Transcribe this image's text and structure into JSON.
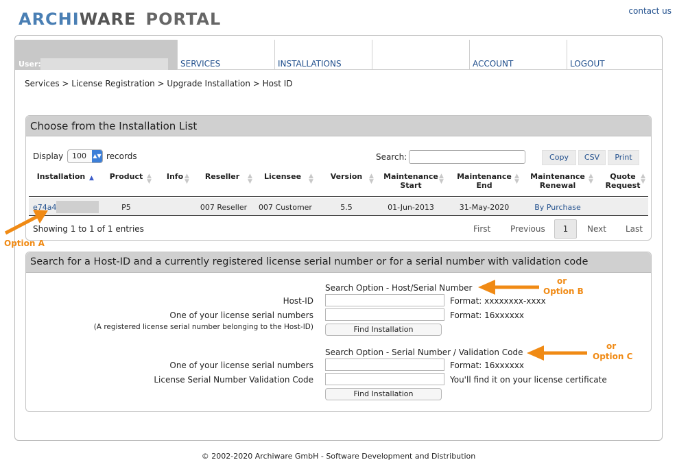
{
  "header": {
    "logo": {
      "part1": "ARCHI",
      "part2": "WARE",
      "part3": "PORTAL"
    },
    "contact": "contact us"
  },
  "nav": {
    "user_label": "User:",
    "tabs": [
      "SERVICES",
      "INSTALLATIONS",
      "",
      "ACCOUNT",
      "LOGOUT"
    ]
  },
  "breadcrumb": "Services > License Registration > Upgrade Installation > Host ID",
  "installation_list": {
    "title": "Choose from the Installation List",
    "display_label": "Display",
    "display_value": "100",
    "records_label": "records",
    "search_label": "Search:",
    "buttons": {
      "copy": "Copy",
      "csv": "CSV",
      "print": "Print"
    },
    "columns": [
      {
        "l1": "Installation",
        "l2": ""
      },
      {
        "l1": "Product",
        "l2": ""
      },
      {
        "l1": "Info",
        "l2": ""
      },
      {
        "l1": "Reseller",
        "l2": ""
      },
      {
        "l1": "Licensee",
        "l2": ""
      },
      {
        "l1": "Version",
        "l2": ""
      },
      {
        "l1": "Maintenance",
        "l2": "Start"
      },
      {
        "l1": "Maintenance",
        "l2": "End"
      },
      {
        "l1": "Maintenance",
        "l2": "Renewal"
      },
      {
        "l1": "Quote",
        "l2": "Request"
      }
    ],
    "row": {
      "installation": "e74a4",
      "product": "P5",
      "info": "",
      "reseller": "007 Reseller",
      "licensee": "007 Customer",
      "version": "5.5",
      "maint_start": "01-Jun-2013",
      "maint_end": "31-May-2020",
      "maint_renewal": "By Purchase",
      "quote": ""
    },
    "showing": "Showing 1 to 1 of 1 entries",
    "pager": {
      "first": "First",
      "previous": "Previous",
      "current": "1",
      "next": "Next",
      "last": "Last"
    }
  },
  "search_panel": {
    "title": "Search for a Host-ID and a currently registered license serial number or for a serial number with validation code",
    "option_b": {
      "title": "Search Option - Host/Serial Number",
      "host_label": "Host-ID",
      "host_format": "Format: xxxxxxxx-xxxx",
      "serial_label": "One of your license serial numbers",
      "serial_format": "Format: 16xxxxxx",
      "note": "(A registered license serial number belonging to the Host-ID)",
      "button": "Find Installation"
    },
    "option_c": {
      "title": "Search Option - Serial Number / Validation Code",
      "serial_label": "One of your license serial numbers",
      "serial_format": "Format: 16xxxxxx",
      "validation_label": "License Serial Number Validation Code",
      "validation_hint": "You'll find it on your license certificate",
      "button": "Find Installation"
    }
  },
  "annotations": {
    "a": "Option A",
    "b_or": "or",
    "b": "Option B",
    "c_or": "or",
    "c": "Option C",
    "color": "#f08a14"
  },
  "footer": "© 2002-2020 Archiware GmbH - Software Development and Distribution"
}
